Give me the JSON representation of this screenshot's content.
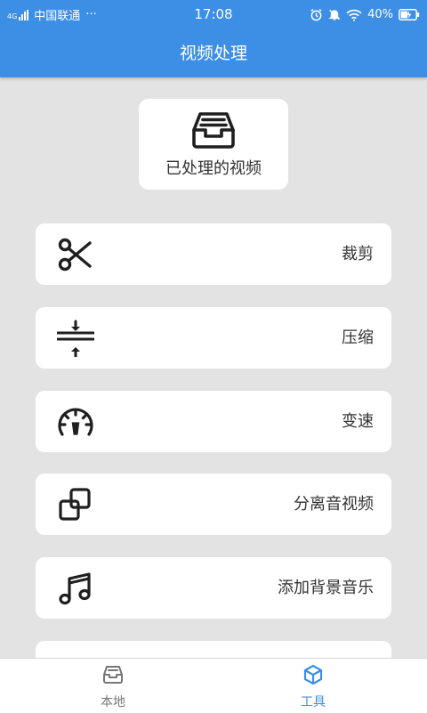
{
  "status_bar": {
    "network_type": "4G",
    "carrier": "中国联通",
    "more": "···",
    "time": "17:08",
    "battery": "40%",
    "icons": [
      "signal-icon",
      "alarm-icon",
      "mute-icon",
      "wifi-icon",
      "battery-charging-icon"
    ]
  },
  "app_bar": {
    "title": "视频处理"
  },
  "processed_card": {
    "label": "已处理的视频",
    "icon": "inbox-tray-icon"
  },
  "tools": [
    {
      "label": "裁剪",
      "icon": "scissors-icon"
    },
    {
      "label": "压缩",
      "icon": "compress-icon"
    },
    {
      "label": "变速",
      "icon": "speedometer-icon"
    },
    {
      "label": "分离音视频",
      "icon": "separate-icon"
    },
    {
      "label": "添加背景音乐",
      "icon": "music-icon"
    }
  ],
  "bottom_nav": {
    "items": [
      {
        "label": "本地",
        "icon": "inbox-icon",
        "active": false
      },
      {
        "label": "工具",
        "icon": "cube-icon",
        "active": true
      }
    ]
  },
  "colors": {
    "primary": "#3d8fe6",
    "background": "#e3e3e3",
    "card": "#ffffff",
    "text": "#333333",
    "inactive": "#777777",
    "active": "#3d8fe6"
  }
}
